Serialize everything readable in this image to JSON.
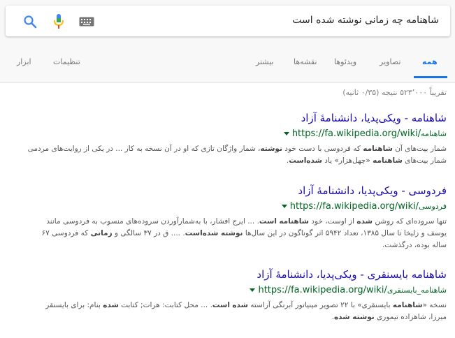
{
  "search": {
    "query": "شاهنامه چه زمانی نوشته شده است"
  },
  "icons": {
    "search": "search-icon",
    "mic": "microphone-icon",
    "keyboard": "keyboard-icon"
  },
  "colors": {
    "accent": "#1a73e8",
    "link": "#1a0dab",
    "url": "#006621"
  },
  "tabs": {
    "all": "همه",
    "images": "تصاویر",
    "videos": "ویدئوها",
    "maps": "نقشه‌ها",
    "more": "بیشتر",
    "settings": "تنظیمات",
    "tools": "ابزار"
  },
  "stats": "تقریباً ۵۲۳٬۰۰۰ نتیجه (۰/۳۵ ثانیه)",
  "results": [
    {
      "title": "شاهنامه - ویکی‌پدیا، دانشنامهٔ آزاد",
      "url": "https://fa.wikipedia.org/wiki/",
      "crumb": "شاهنامه",
      "snippet": [
        {
          "t": "شمار بیت‌های آن "
        },
        {
          "t": "شاهنامه",
          "b": true
        },
        {
          "t": " که فردوسی با دست خود "
        },
        {
          "t": "نوشته",
          "b": true
        },
        {
          "t": "، شمار واژگان تازی که او در آن نسخه به کار ... در یکی از روایت‌های مردمی شمار بیت‌های "
        },
        {
          "t": "شاهنامه",
          "b": true
        },
        {
          "t": " «چهل‌هزار» یاد "
        },
        {
          "t": "شده‌است",
          "b": true
        },
        {
          "t": "."
        }
      ]
    },
    {
      "title": "فردوسی - ویکی‌پدیا، دانشنامهٔ آزاد",
      "url": "https://fa.wikipedia.org/wiki/",
      "crumb": "فردوسی",
      "snippet": [
        {
          "t": "تنها سروده‌ای که روشن "
        },
        {
          "t": "شده",
          "b": true
        },
        {
          "t": " از اوست، خود "
        },
        {
          "t": "شاهنامه",
          "b": true
        },
        {
          "t": " "
        },
        {
          "t": "است",
          "b": true
        },
        {
          "t": ". ... ایرج افشار، با به‌شمارآوردن سروده‌های منسوب به فردوسی مانند یوسف و زلیخا تا سال ۱۳۸۵، تعداد ۵۹۴۲ اثر گوناگون در این سال‌ها "
        },
        {
          "t": "نوشته شده‌است",
          "b": true
        },
        {
          "t": ". .... ق در ۳۷ سالگی و "
        },
        {
          "t": "زمانی",
          "b": true
        },
        {
          "t": " که فردوسی ۶۷ ساله بوده، درگذشت."
        }
      ]
    },
    {
      "title": "شاهنامه بایسنقری - ویکی‌پدیا، دانشنامهٔ آزاد",
      "url": "https://fa.wikipedia.org/wiki/",
      "crumb": "شاهنامه_بایسنقری",
      "snippet": [
        {
          "t": "نسخه «"
        },
        {
          "t": "شاهنامه",
          "b": true
        },
        {
          "t": " بایسنقری» با ۲۲ تصویر مینیاتور آبرنگی آراسته "
        },
        {
          "t": "شده",
          "b": true
        },
        {
          "t": " "
        },
        {
          "t": "است",
          "b": true
        },
        {
          "t": ". ... محل کتابت: هرات; کتابت "
        },
        {
          "t": "شده",
          "b": true
        },
        {
          "t": " بنام: برای بایسنقر میرزا، شاهزاده تیموری "
        },
        {
          "t": "نوشته شده",
          "b": true
        },
        {
          "t": "."
        }
      ]
    }
  ]
}
